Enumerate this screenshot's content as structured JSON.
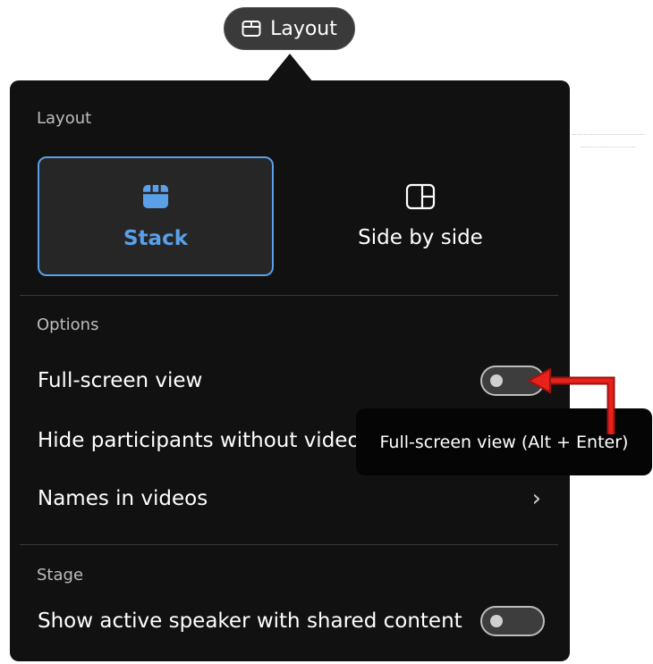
{
  "top_button": {
    "label": "Layout",
    "icon": "layout-icon"
  },
  "panel": {
    "layout_section": {
      "label": "Layout",
      "options": [
        {
          "label": "Stack",
          "icon": "stack-icon",
          "selected": true
        },
        {
          "label": "Side by side",
          "icon": "side-by-side-icon",
          "selected": false
        }
      ]
    },
    "options_section": {
      "label": "Options",
      "items": [
        {
          "label": "Full-screen view",
          "control": "toggle",
          "on": false
        },
        {
          "label": "Hide participants without video",
          "control": "none"
        },
        {
          "label": "Names in videos",
          "control": "chevron"
        }
      ]
    },
    "stage_section": {
      "label": "Stage",
      "items": [
        {
          "label": "Show active speaker with shared content",
          "control": "toggle",
          "on": false
        }
      ]
    }
  },
  "tooltip": {
    "text": "Full-screen view (Alt + Enter)"
  },
  "colors": {
    "panel_bg": "#111111",
    "accent": "#5aa0e8",
    "annotation": "#e8211b"
  }
}
